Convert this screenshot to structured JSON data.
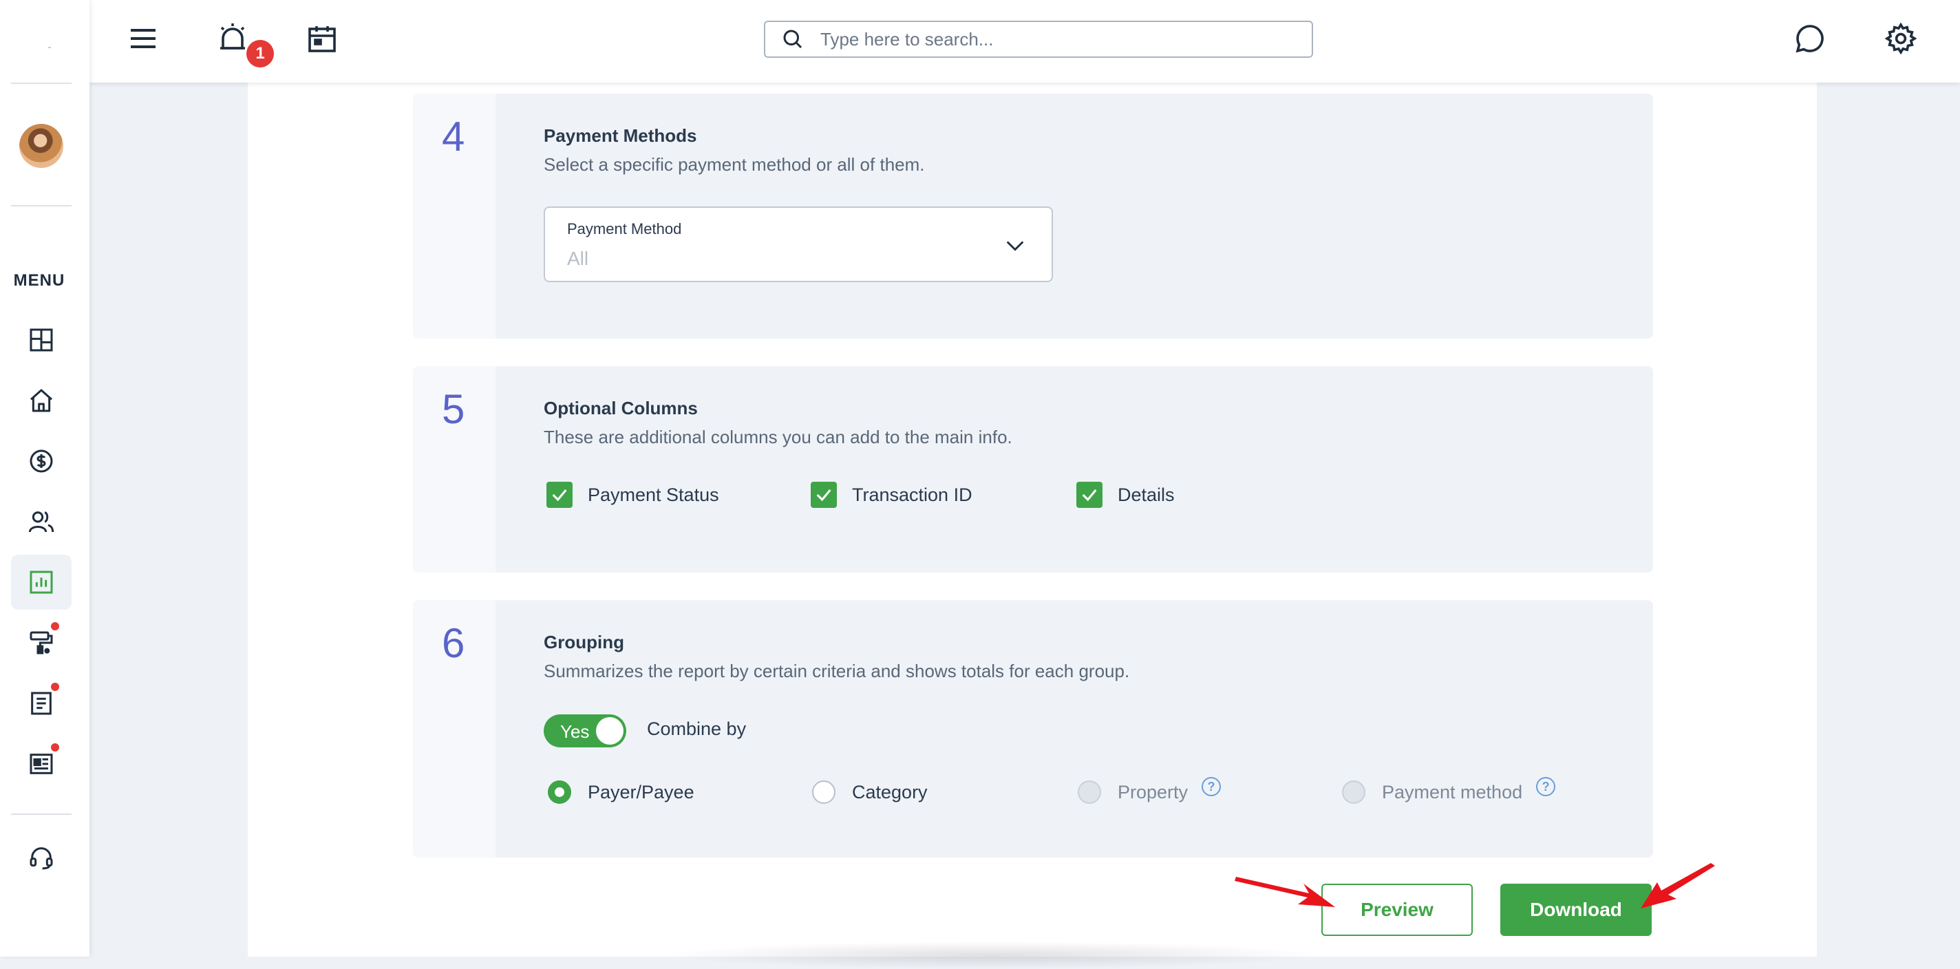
{
  "header": {
    "search_placeholder": "Type here to search...",
    "notification_count": "1"
  },
  "sidebar": {
    "menu_label": "MENU"
  },
  "sections": [
    {
      "number": "4",
      "title": "Payment Methods",
      "description": "Select a specific payment method or all of them.",
      "select": {
        "label": "Payment Method",
        "value": "All"
      }
    },
    {
      "number": "5",
      "title": "Optional Columns",
      "description": "These are additional columns you can add to the main info.",
      "checkboxes": [
        {
          "label": "Payment Status",
          "checked": true
        },
        {
          "label": "Transaction ID",
          "checked": true
        },
        {
          "label": "Details",
          "checked": true
        }
      ]
    },
    {
      "number": "6",
      "title": "Grouping",
      "description": "Summarizes the report by certain criteria and shows totals for each group.",
      "toggle": {
        "label": "Yes",
        "on": true
      },
      "combine_label": "Combine by",
      "radios": [
        {
          "label": "Payer/Payee",
          "checked": true,
          "disabled": false
        },
        {
          "label": "Category",
          "checked": false,
          "disabled": false
        },
        {
          "label": "Property",
          "checked": false,
          "disabled": true
        },
        {
          "label": "Payment method",
          "checked": false,
          "disabled": true
        }
      ],
      "help_icon_text": "?"
    }
  ],
  "actions": {
    "preview_label": "Preview",
    "download_label": "Download"
  },
  "colors": {
    "accent_green": "#3fa447",
    "section_number": "#5b63c9",
    "annotation_arrow": "#e8141b"
  }
}
